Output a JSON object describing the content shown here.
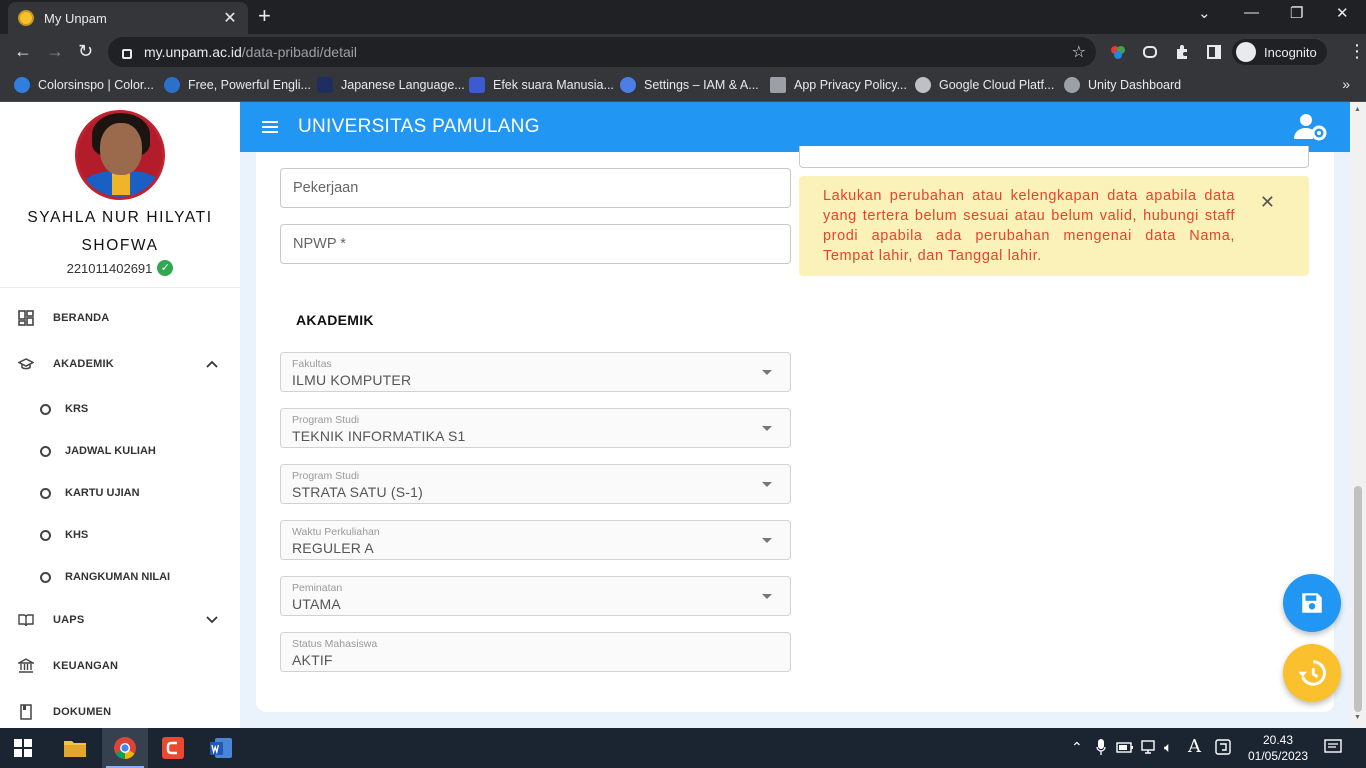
{
  "browser": {
    "tab_title": "My Unpam",
    "tab_close": "✕",
    "new_tab": "+",
    "url_host": "my.unpam.ac.id",
    "url_path": "/data-pribadi/detail",
    "incognito_label": "Incognito",
    "window_controls": {
      "minimize": "—",
      "restore": "❐",
      "close": "✕"
    },
    "bookmarks": [
      {
        "label": "Colorsinspo | Color...",
        "color": "#2f7fe0"
      },
      {
        "label": "Free, Powerful Engli...",
        "color": "#2b70c9"
      },
      {
        "label": "Japanese Language...",
        "color": "#1d2f61"
      },
      {
        "label": "Efek suara Manusia...",
        "color": "#3d5bd1"
      },
      {
        "label": "Settings – IAM & A...",
        "color": "#4a7fe8"
      },
      {
        "label": "App Privacy Policy...",
        "color": "#9aa0a6"
      },
      {
        "label": "Google Cloud Platf...",
        "color": "#bdc1c6"
      },
      {
        "label": "Unity Dashboard",
        "color": "#9aa0a6"
      }
    ],
    "bookmarks_more": "»"
  },
  "app": {
    "title": "UNIVERSITAS PAMULANG",
    "primary_color": "#2196f3"
  },
  "profile": {
    "name": "SYAHLA NUR HILYATI SHOFWA",
    "nim": "221011402691",
    "verified_mark": "✓"
  },
  "sidebar": {
    "items": [
      {
        "label": "BERANDA",
        "icon": "dashboard-icon"
      },
      {
        "label": "AKADEMIK",
        "icon": "graduation-cap-icon",
        "expanded": true
      },
      {
        "label": "UAPS",
        "icon": "book-icon",
        "expanded": false
      },
      {
        "label": "KEUANGAN",
        "icon": "bank-icon"
      },
      {
        "label": "DOKUMEN",
        "icon": "document-icon"
      }
    ],
    "akademik_sub": [
      "KRS",
      "JADWAL KULIAH",
      "KARTU UJIAN",
      "KHS",
      "RANGKUMAN NILAI"
    ]
  },
  "form": {
    "pekerjaan_placeholder": "Pekerjaan",
    "npwp_placeholder": "NPWP *",
    "section_akademik": "AKADEMIK",
    "academic": [
      {
        "label": "Fakultas",
        "value": "ILMU KOMPUTER",
        "dropdown": true
      },
      {
        "label": "Program Studi",
        "value": "TEKNIK INFORMATIKA S1",
        "dropdown": true
      },
      {
        "label": "Program Studi",
        "value": "STRATA SATU (S-1)",
        "dropdown": true
      },
      {
        "label": "Waktu Perkuliahan",
        "value": "REGULER A",
        "dropdown": true
      },
      {
        "label": "Peminatan",
        "value": "UTAMA",
        "dropdown": true
      },
      {
        "label": "Status Mahasiswa",
        "value": "AKTIF",
        "dropdown": false
      }
    ]
  },
  "alert": {
    "text": "Lakukan perubahan atau kelengkapan data apabila data yang tertera belum sesuai atau belum valid, hubungi staff prodi apabila ada perubahan mengenai data Nama, Tempat lahir, dan Tanggal lahir.",
    "close": "✕",
    "bg": "#faf2b8",
    "fg": "#e8432a"
  },
  "fabs": {
    "save_color": "#2196f3",
    "history_color": "#fbc02d"
  },
  "taskbar": {
    "time": "20.43",
    "date": "01/05/2023",
    "lang": "A"
  }
}
